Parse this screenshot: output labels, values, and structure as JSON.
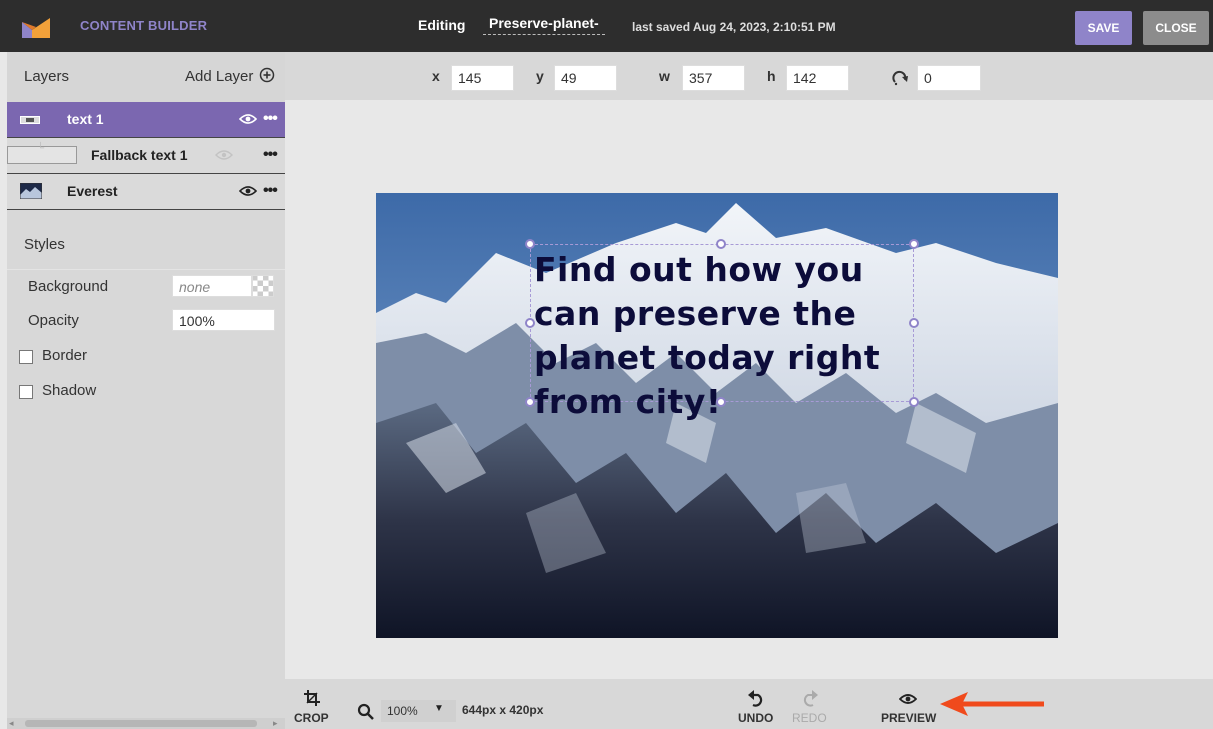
{
  "header": {
    "app_title": "CONTENT BUILDER",
    "editing_label": "Editing",
    "doc_title": "Preserve-planet-",
    "last_saved": "last saved Aug 24, 2023, 2:10:51 PM",
    "save_label": "SAVE",
    "close_label": "CLOSE",
    "colors": {
      "accent": "#8f84c9",
      "bar": "#2d2d2d",
      "close": "#8c8c8c"
    }
  },
  "layers": {
    "title": "Layers",
    "add_label": "Add Layer",
    "items": [
      {
        "label": "text 1",
        "selected": true,
        "visible": true
      },
      {
        "label": "Fallback text 1",
        "selected": false,
        "visible": false
      },
      {
        "label": "Everest",
        "selected": false,
        "visible": true
      }
    ]
  },
  "styles": {
    "title": "Styles",
    "background_label": "Background",
    "background_value": "none",
    "opacity_label": "Opacity",
    "opacity_value": "100%",
    "border_label": "Border",
    "shadow_label": "Shadow"
  },
  "fields": {
    "x_label": "x",
    "x_value": "145",
    "y_label": "y",
    "y_value": "49",
    "w_label": "w",
    "w_value": "357",
    "h_label": "h",
    "h_value": "142",
    "rotate_value": "0"
  },
  "canvas": {
    "headline": "Find out how you can preserve the planet today right from city!"
  },
  "bottom": {
    "crop_label": "CROP",
    "zoom_value": "100%",
    "dimensions": "644px x 420px",
    "undo_label": "UNDO",
    "redo_label": "REDO",
    "preview_label": "PREVIEW"
  }
}
